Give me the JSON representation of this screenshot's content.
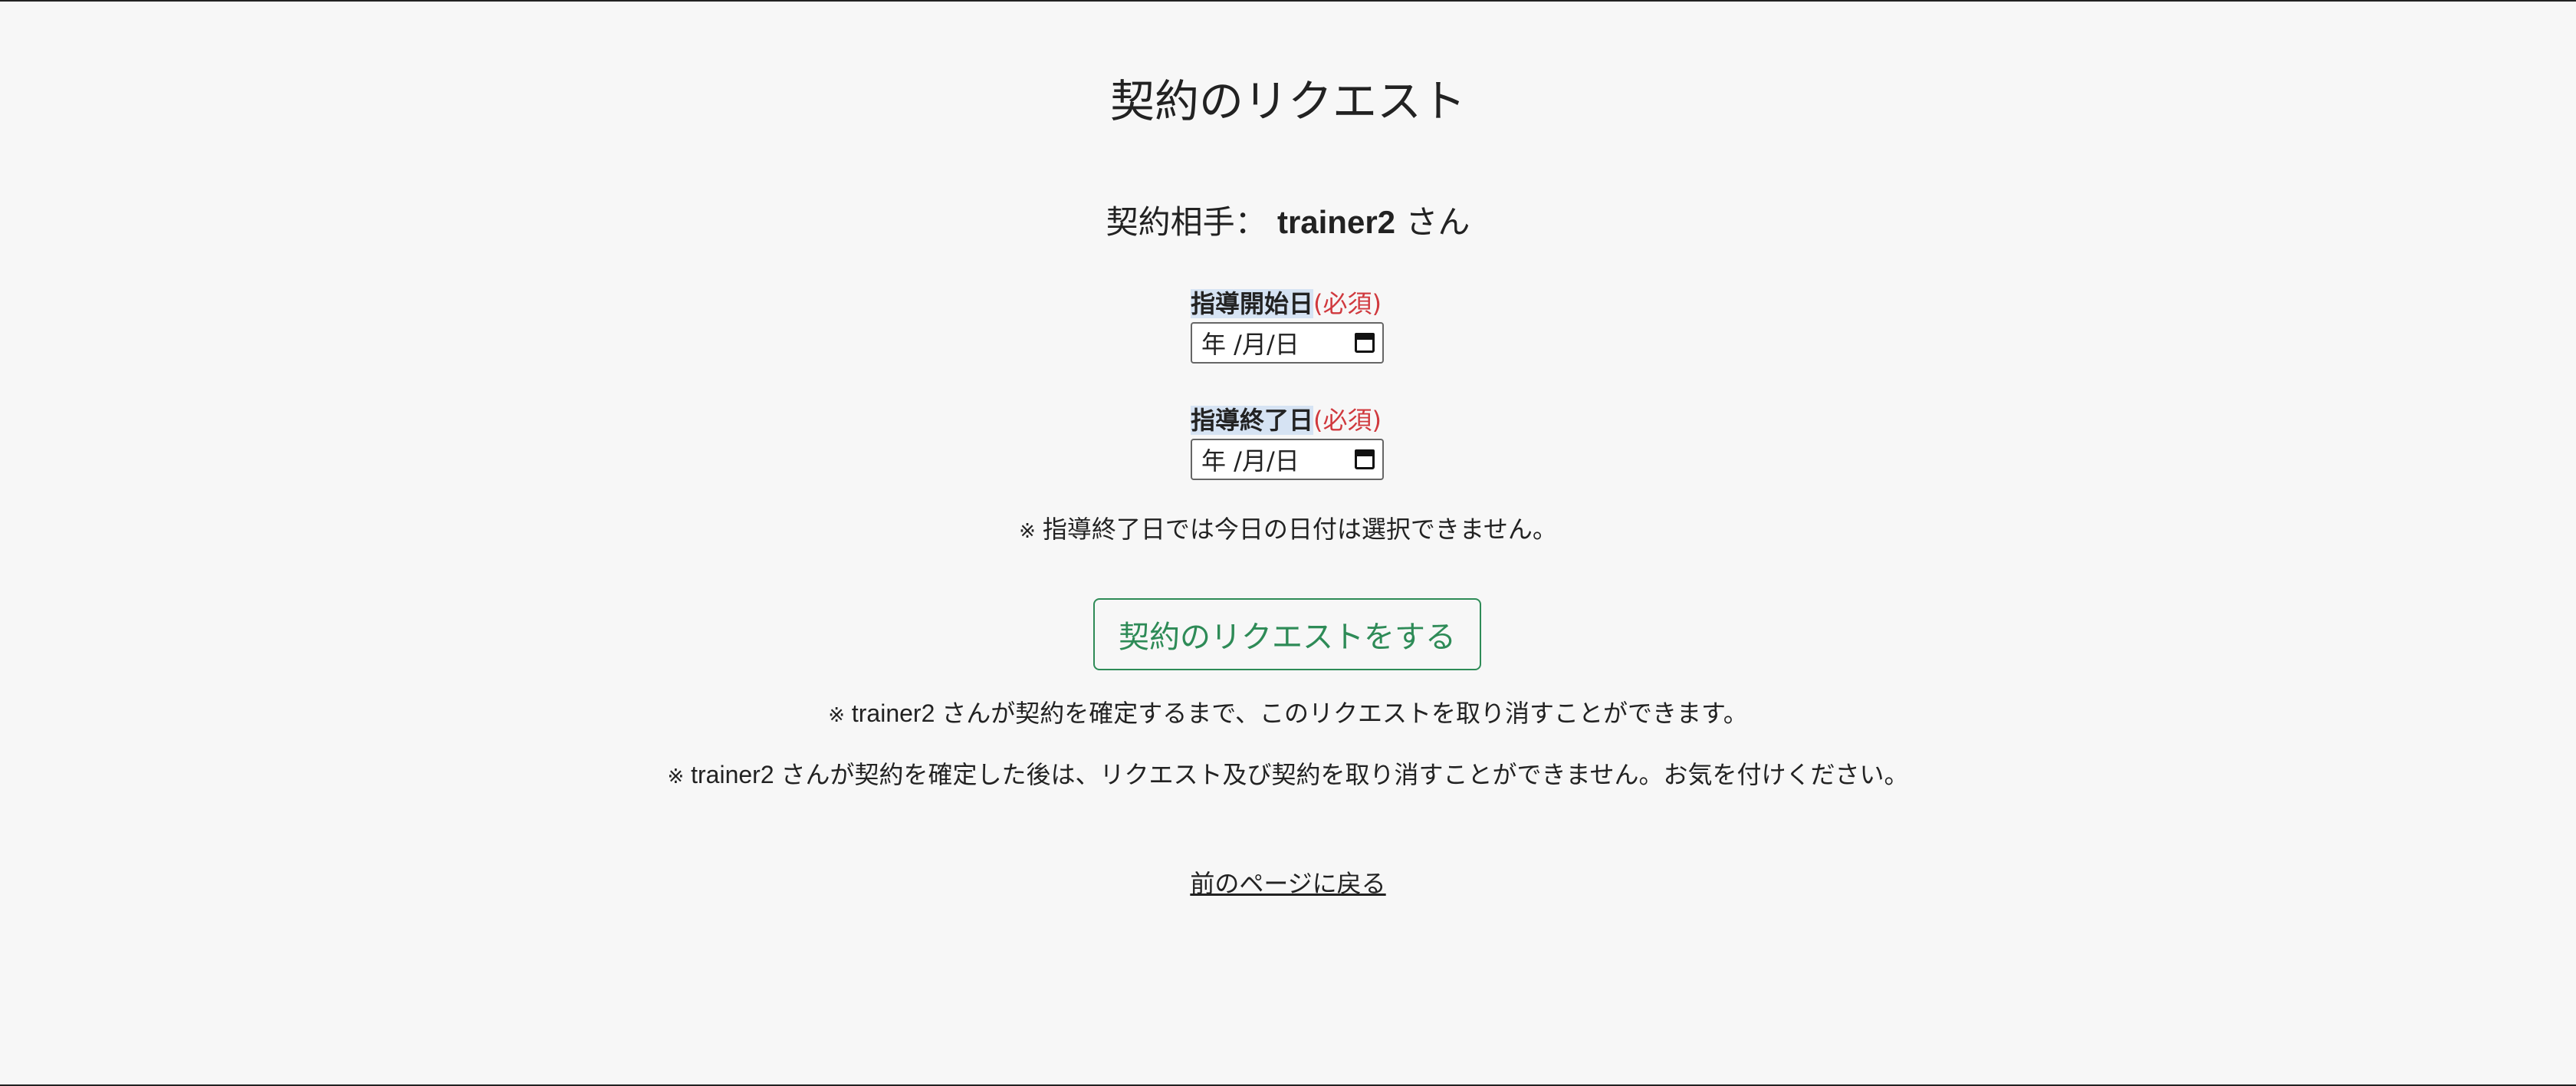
{
  "page": {
    "title": "契約のリクエスト"
  },
  "partner": {
    "prefix": "契約相手：",
    "name": "trainer2",
    "suffix": "さん"
  },
  "form": {
    "start_date": {
      "label": "指導開始日",
      "required": "(必須)",
      "placeholder": "年 /月/日"
    },
    "end_date": {
      "label": "指導終了日",
      "required": "(必須)",
      "placeholder": "年 /月/日"
    },
    "end_date_note_mark": "※",
    "end_date_note": "指導終了日では今日の日付は選択できません。",
    "submit_label": "契約のリクエストをする"
  },
  "notes": [
    {
      "mark": "※",
      "text": "trainer2 さんが契約を確定するまで、このリクエストを取り消すことができます。"
    },
    {
      "mark": "※",
      "text": "trainer2 さんが契約を確定した後は、リクエスト及び契約を取り消すことができません。お気を付けください。"
    }
  ],
  "back_link": "前のページに戻る",
  "icons": {
    "calendar": "calendar-icon"
  },
  "colors": {
    "background": "#f7f7f7",
    "required": "#d0393e",
    "button": "#2e8b57",
    "label_highlight": "#d6e3f3"
  }
}
